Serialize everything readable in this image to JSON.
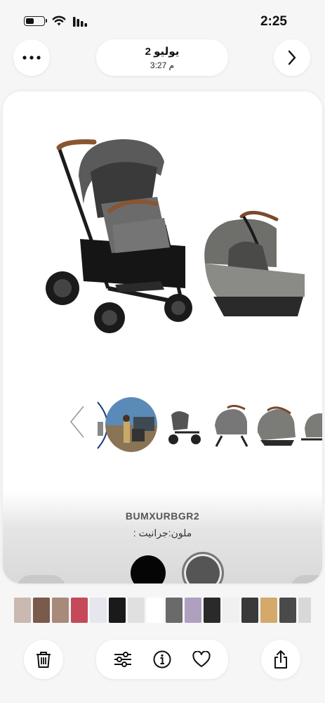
{
  "status_bar": {
    "time": "2:25"
  },
  "header": {
    "title": "2 يوليو",
    "subtitle": "3:27 م"
  },
  "product": {
    "sku": "BUMXURBGR2",
    "color_label": "ملون:جرانيت  :"
  },
  "colors": {
    "accent": "#111111",
    "swatch_black": "#050505",
    "swatch_gray": "#555555"
  },
  "icons": {
    "more": "ellipsis-icon",
    "next": "chevron-right-icon",
    "prev": "chevron-left-icon",
    "delete": "trash-icon",
    "adjust": "sliders-icon",
    "info": "info-icon",
    "favorite": "heart-icon",
    "share": "share-icon"
  }
}
